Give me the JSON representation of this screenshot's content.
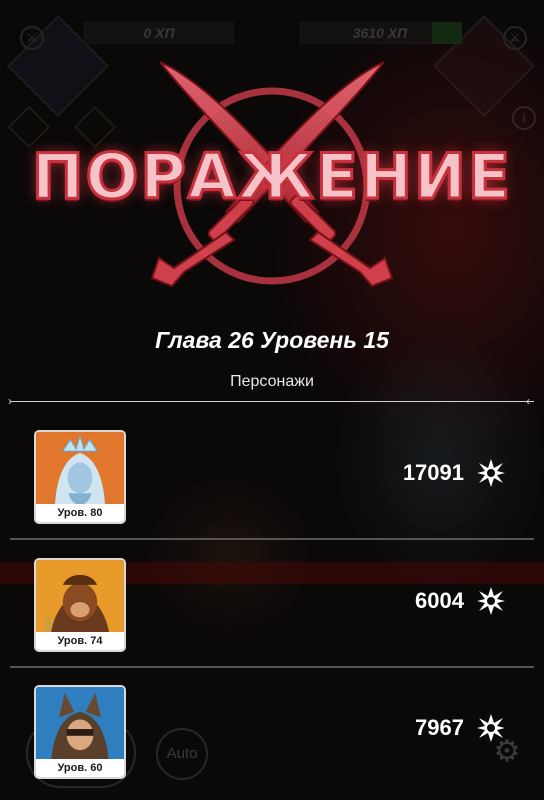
{
  "hud": {
    "player_hp": "0 ХП",
    "enemy_hp": "3610 ХП"
  },
  "result": {
    "title": "ПОРАЖЕНИЕ",
    "chapter_level": "Глава 26 Уровень 15",
    "section_label": "Персонажи"
  },
  "heroes": [
    {
      "level": "Уров. 80",
      "damage": "17091",
      "portrait": "ice-queen-portrait"
    },
    {
      "level": "Уров. 74",
      "damage": "6004",
      "portrait": "monkey-warrior-portrait"
    },
    {
      "level": "Уров. 60",
      "damage": "7967",
      "portrait": "hooded-cat-portrait"
    }
  ],
  "controls": {
    "auto_label": "Auto",
    "settings_icon": "gear-icon"
  },
  "colors": {
    "title_fill": "#f6c3c8",
    "title_stroke": "#c8323e",
    "emblem": "#e0505c",
    "background": "#0e0b0c"
  }
}
